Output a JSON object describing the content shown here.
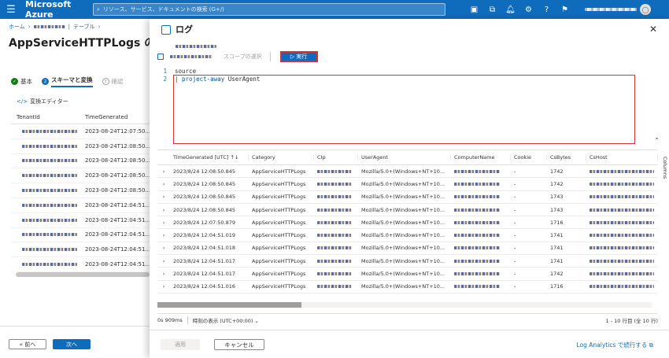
{
  "topbar": {
    "brand": "Microsoft Azure",
    "search_placeholder": "リソース、サービス、ドキュメントの検索 (G+/)",
    "icons": [
      "cloud-shell-icon",
      "directory-icon",
      "bell-icon",
      "gear-icon",
      "help-icon",
      "feedback-icon"
    ]
  },
  "left": {
    "breadcrumb": {
      "home": "ホーム",
      "table": "テーブル"
    },
    "title": "AppServiceHTTPLogs の変換",
    "steps": [
      {
        "label": "基本",
        "num": "✓"
      },
      {
        "label": "スキーマと変換",
        "num": "2"
      },
      {
        "label": "確認",
        "num": "3"
      }
    ],
    "editor_link": "変換エディター",
    "table": {
      "headers": [
        "TenantId",
        "TimeGenerated"
      ],
      "rows": [
        "2023-08-24T12:07:50...",
        "2023-08-24T12:08:50...",
        "2023-08-24T12:08:50...",
        "2023-08-24T12:08:50...",
        "2023-08-24T12:08:50...",
        "2023-08-24T12:04:51...",
        "2023-08-24T12:04:51...",
        "2023-08-24T12:04:51...",
        "2023-08-24T12:04:51...",
        "2023-08-24T12:04:51..."
      ]
    },
    "prev_button": "« 前へ",
    "next_button": "次へ"
  },
  "panel": {
    "title": "ログ",
    "scope_label": "スコープの選択",
    "run_button": "実行",
    "code_lines": [
      {
        "num": "1",
        "text": "source"
      },
      {
        "num": "2",
        "kw": "project-away",
        "rest": " UserAgent"
      }
    ],
    "columns_side": "Columns",
    "results": {
      "headers": [
        "TimeGenerated [UTC]",
        "Category",
        "CIp",
        "UserAgent",
        "ComputerName",
        "Cookie",
        "CsBytes",
        "CsHost"
      ],
      "rows": [
        {
          "time": "2023/8/24 12:08:50.845",
          "category": "AppServiceHTTPLogs",
          "ua": "Mozilla/5.0+(Windows+NT+10...",
          "cookie": "-",
          "bytes": "1742"
        },
        {
          "time": "2023/8/24 12:08:50.845",
          "category": "AppServiceHTTPLogs",
          "ua": "Mozilla/5.0+(Windows+NT+10...",
          "cookie": "-",
          "bytes": "1742"
        },
        {
          "time": "2023/8/24 12:08:50.845",
          "category": "AppServiceHTTPLogs",
          "ua": "Mozilla/5.0+(Windows+NT+10...",
          "cookie": "-",
          "bytes": "1743"
        },
        {
          "time": "2023/8/24 12:08:50.845",
          "category": "AppServiceHTTPLogs",
          "ua": "Mozilla/5.0+(Windows+NT+10...",
          "cookie": "-",
          "bytes": "1743"
        },
        {
          "time": "2023/8/24 12:07:50.879",
          "category": "AppServiceHTTPLogs",
          "ua": "Mozilla/5.0+(Windows+NT+10...",
          "cookie": "-",
          "bytes": "1716"
        },
        {
          "time": "2023/8/24 12:04:51.019",
          "category": "AppServiceHTTPLogs",
          "ua": "Mozilla/5.0+(Windows+NT+10...",
          "cookie": "-",
          "bytes": "1741"
        },
        {
          "time": "2023/8/24 12:04:51.018",
          "category": "AppServiceHTTPLogs",
          "ua": "Mozilla/5.0+(Windows+NT+10...",
          "cookie": "-",
          "bytes": "1741"
        },
        {
          "time": "2023/8/24 12:04:51.017",
          "category": "AppServiceHTTPLogs",
          "ua": "Mozilla/5.0+(Windows+NT+10...",
          "cookie": "-",
          "bytes": "1741"
        },
        {
          "time": "2023/8/24 12:04:51.017",
          "category": "AppServiceHTTPLogs",
          "ua": "Mozilla/5.0+(Windows+NT+10...",
          "cookie": "-",
          "bytes": "1742"
        },
        {
          "time": "2023/8/24 12:04:51.016",
          "category": "AppServiceHTTPLogs",
          "ua": "Mozilla/5.0+(Windows+NT+10...",
          "cookie": "-",
          "bytes": "1716"
        }
      ]
    },
    "status": {
      "duration": "0s 909ms",
      "timezone": "時刻の表示 (UTC+00:00)",
      "count": "1 - 10 行目 (全 10 行)"
    },
    "apply_button": "適用",
    "cancel_button": "キャンセル",
    "la_link": "Log Analytics で続行する"
  },
  "colors": {
    "accent": "#0f6cbd",
    "highlight": "#d13438"
  }
}
